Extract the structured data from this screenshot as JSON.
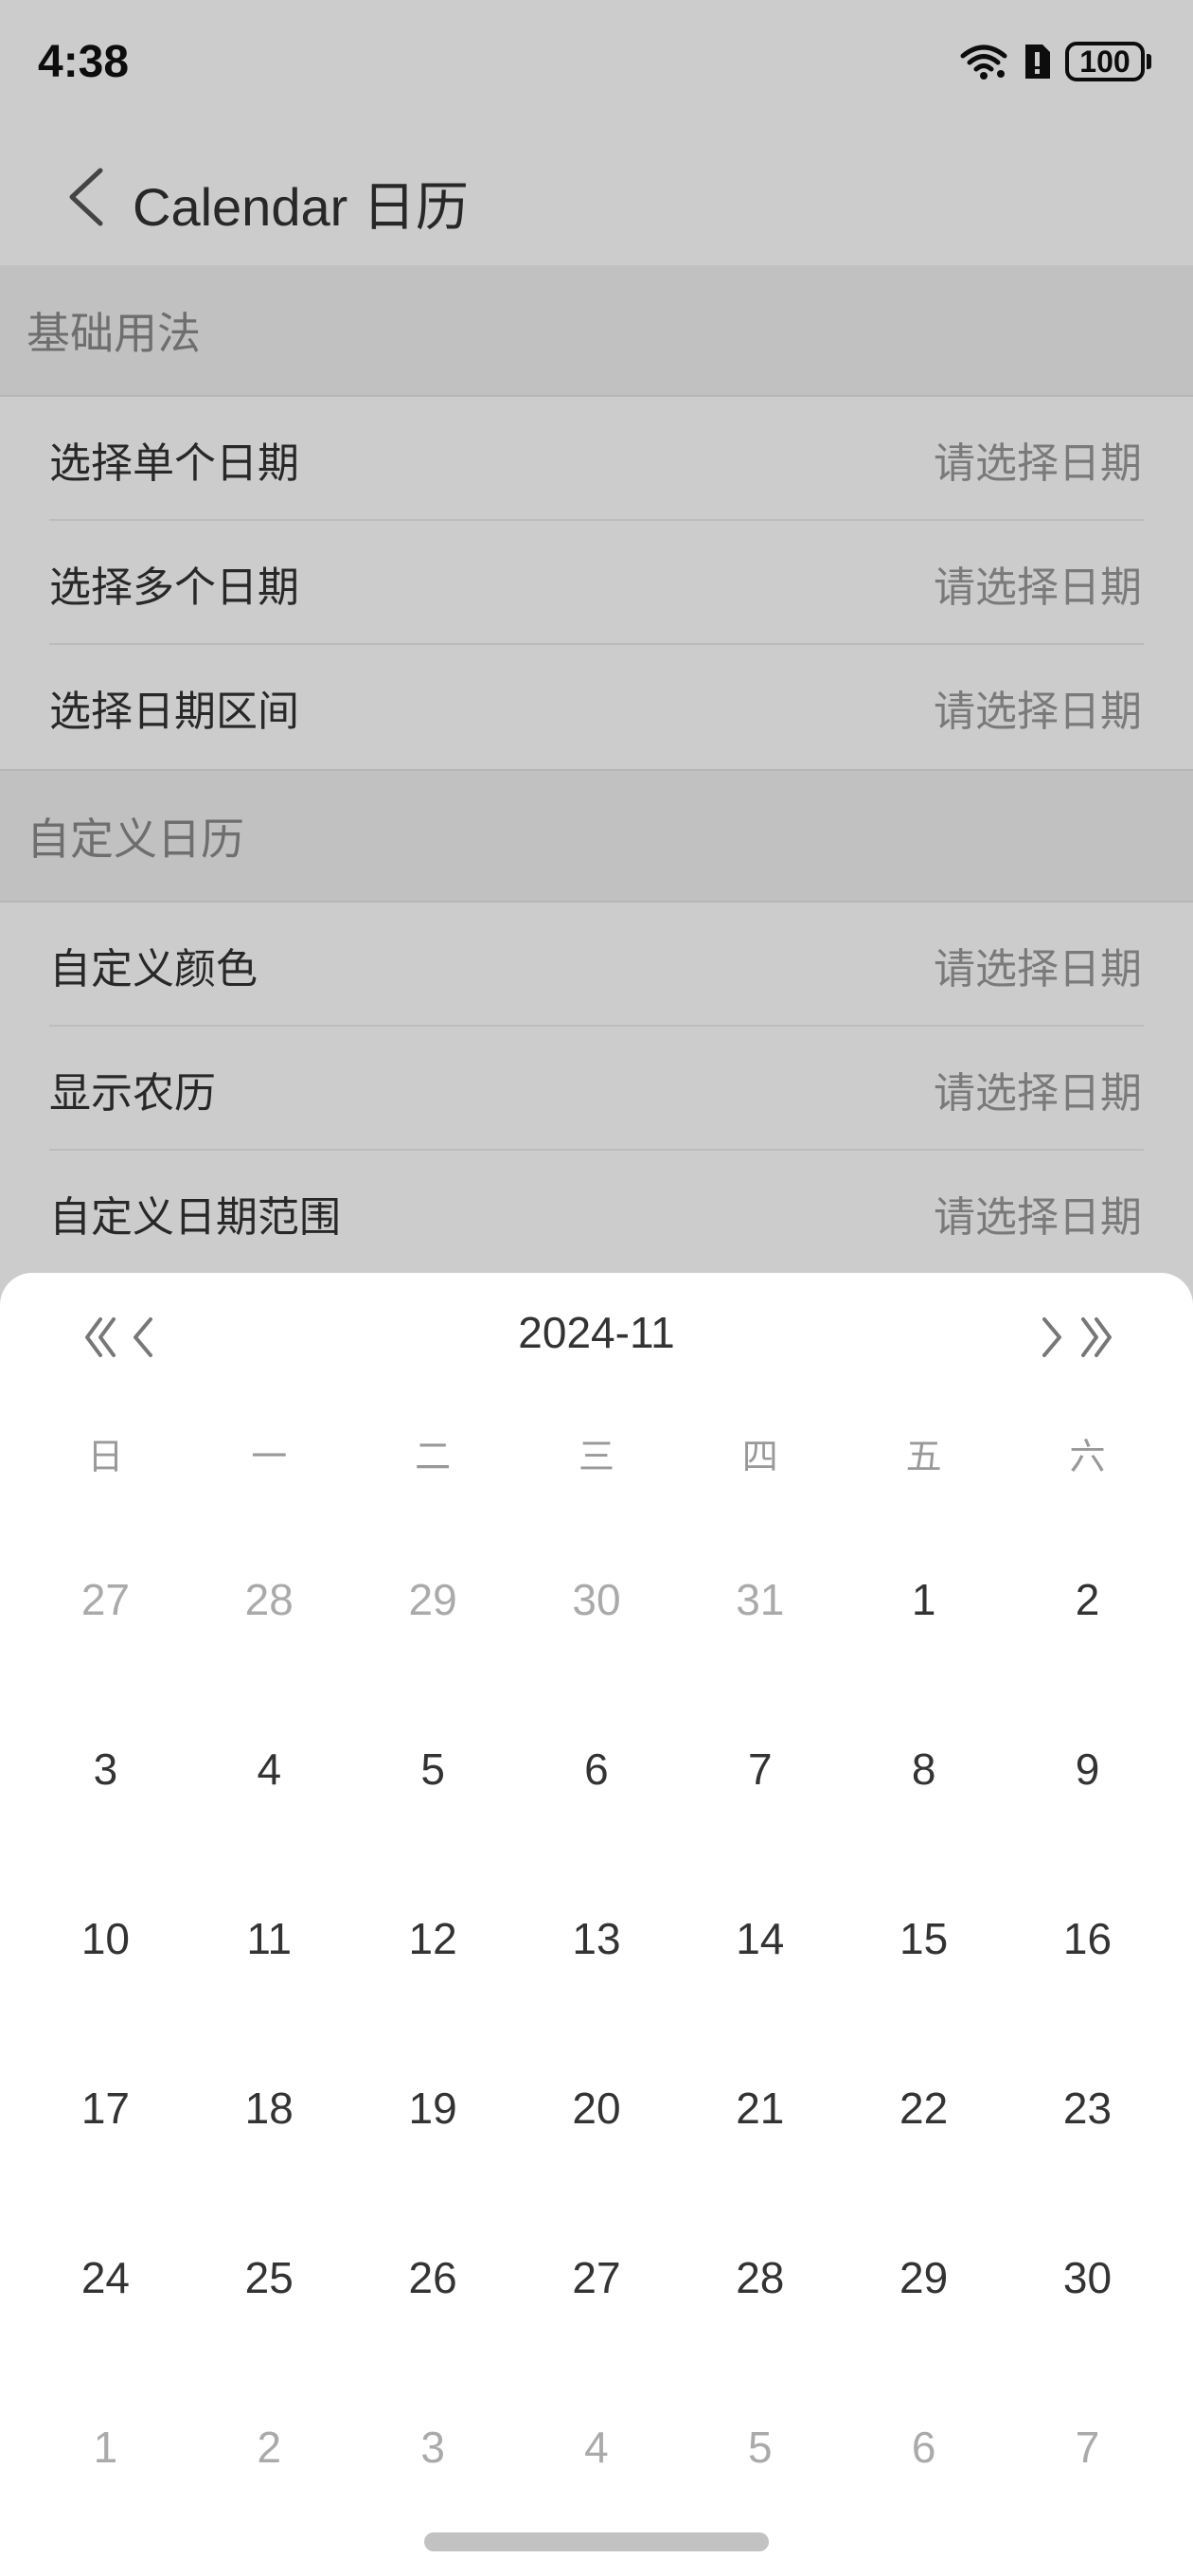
{
  "status": {
    "time": "4:38",
    "battery": "100"
  },
  "header": {
    "title": "Calendar 日历"
  },
  "sections": [
    {
      "title": "基础用法",
      "cells": [
        {
          "label": "选择单个日期",
          "value": "请选择日期"
        },
        {
          "label": "选择多个日期",
          "value": "请选择日期"
        },
        {
          "label": "选择日期区间",
          "value": "请选择日期"
        }
      ]
    },
    {
      "title": "自定义日历",
      "cells": [
        {
          "label": "自定义颜色",
          "value": "请选择日期"
        },
        {
          "label": "显示农历",
          "value": "请选择日期"
        },
        {
          "label": "自定义日期范围",
          "value": "请选择日期"
        }
      ]
    }
  ],
  "calendar": {
    "month": "2024-11",
    "weekdays": [
      "日",
      "一",
      "二",
      "三",
      "四",
      "五",
      "六"
    ],
    "days": [
      {
        "d": "27",
        "o": true
      },
      {
        "d": "28",
        "o": true
      },
      {
        "d": "29",
        "o": true
      },
      {
        "d": "30",
        "o": true
      },
      {
        "d": "31",
        "o": true
      },
      {
        "d": "1",
        "o": false
      },
      {
        "d": "2",
        "o": false
      },
      {
        "d": "3",
        "o": false
      },
      {
        "d": "4",
        "o": false
      },
      {
        "d": "5",
        "o": false
      },
      {
        "d": "6",
        "o": false
      },
      {
        "d": "7",
        "o": false
      },
      {
        "d": "8",
        "o": false
      },
      {
        "d": "9",
        "o": false
      },
      {
        "d": "10",
        "o": false
      },
      {
        "d": "11",
        "o": false
      },
      {
        "d": "12",
        "o": false
      },
      {
        "d": "13",
        "o": false
      },
      {
        "d": "14",
        "o": false
      },
      {
        "d": "15",
        "o": false
      },
      {
        "d": "16",
        "o": false
      },
      {
        "d": "17",
        "o": false
      },
      {
        "d": "18",
        "o": false
      },
      {
        "d": "19",
        "o": false
      },
      {
        "d": "20",
        "o": false
      },
      {
        "d": "21",
        "o": false
      },
      {
        "d": "22",
        "o": false
      },
      {
        "d": "23",
        "o": false
      },
      {
        "d": "24",
        "o": false
      },
      {
        "d": "25",
        "o": false
      },
      {
        "d": "26",
        "o": false
      },
      {
        "d": "27",
        "o": false
      },
      {
        "d": "28",
        "o": false
      },
      {
        "d": "29",
        "o": false
      },
      {
        "d": "30",
        "o": false
      },
      {
        "d": "1",
        "o": true
      },
      {
        "d": "2",
        "o": true
      },
      {
        "d": "3",
        "o": true
      },
      {
        "d": "4",
        "o": true
      },
      {
        "d": "5",
        "o": true
      },
      {
        "d": "6",
        "o": true
      },
      {
        "d": "7",
        "o": true
      }
    ]
  },
  "icons": {
    "back": "chevron-left-icon",
    "prev_year": "double-chevron-left-icon",
    "prev_month": "chevron-left-icon",
    "next_month": "chevron-right-icon",
    "next_year": "double-chevron-right-icon"
  },
  "colors": {
    "overlay": "#000000",
    "text_primary": "#333333",
    "text_muted": "#999999",
    "section_bg": "#f2f2f2"
  }
}
